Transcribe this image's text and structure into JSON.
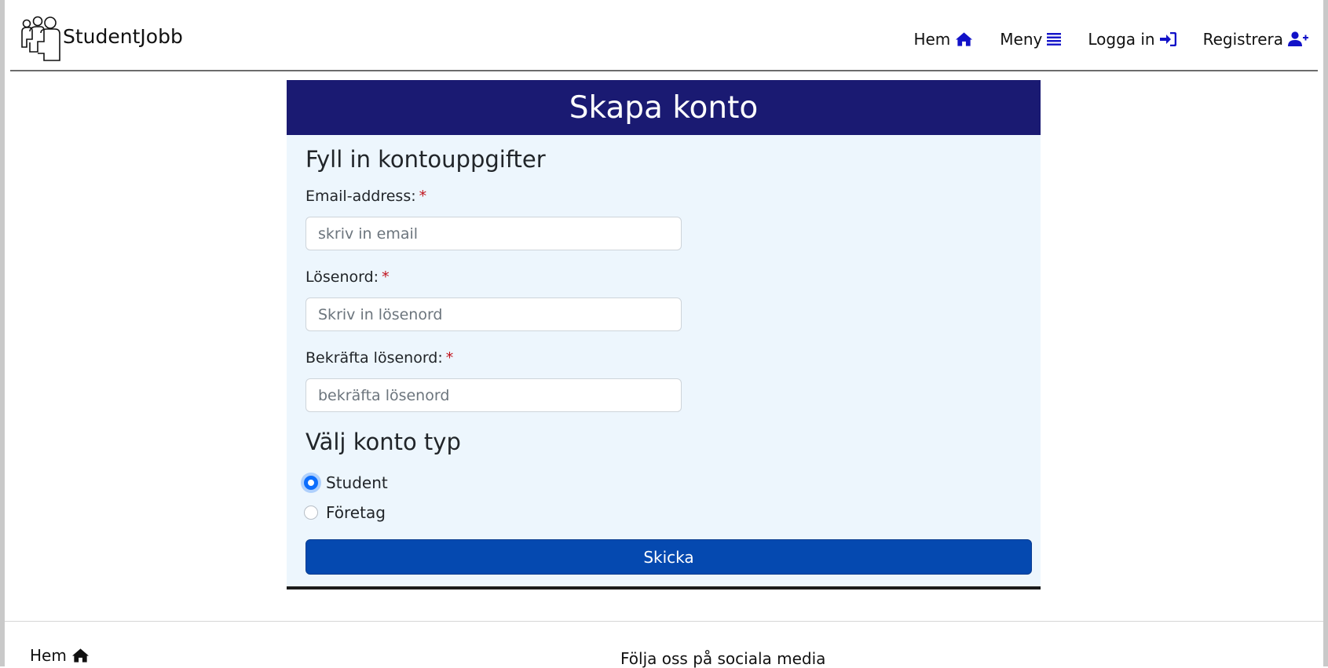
{
  "brand": {
    "name": "StudentJobb",
    "logo_icon": "people-group-icon"
  },
  "nav": {
    "items": [
      {
        "label": "Hem",
        "icon": "home-icon"
      },
      {
        "label": "Meny",
        "icon": "list-icon"
      },
      {
        "label": "Logga in",
        "icon": "sign-in-icon"
      },
      {
        "label": "Registrera",
        "icon": "user-plus-icon"
      }
    ],
    "icon_color": "#1212c8"
  },
  "card": {
    "title": "Skapa konto",
    "header_color": "#1a1a72",
    "section_account": "Fyll in kontouppgifter",
    "email": {
      "label": "Email-address:",
      "required": "*",
      "placeholder": "skriv in email"
    },
    "password": {
      "label": "Lösenord:",
      "required": "*",
      "placeholder": "Skriv in lösenord"
    },
    "confirm": {
      "label": "Bekräfta lösenord:",
      "required": "*",
      "placeholder": "bekräfta lösenord"
    },
    "section_type": "Välj konto typ",
    "account_types": [
      {
        "label": "Student",
        "selected": true
      },
      {
        "label": "Företag",
        "selected": false
      }
    ],
    "submit_label": "Skicka",
    "submit_color": "#0549b0"
  },
  "footer": {
    "home_label": "Hem",
    "home_icon": "home-icon",
    "social_text": "Följa oss på sociala media"
  }
}
